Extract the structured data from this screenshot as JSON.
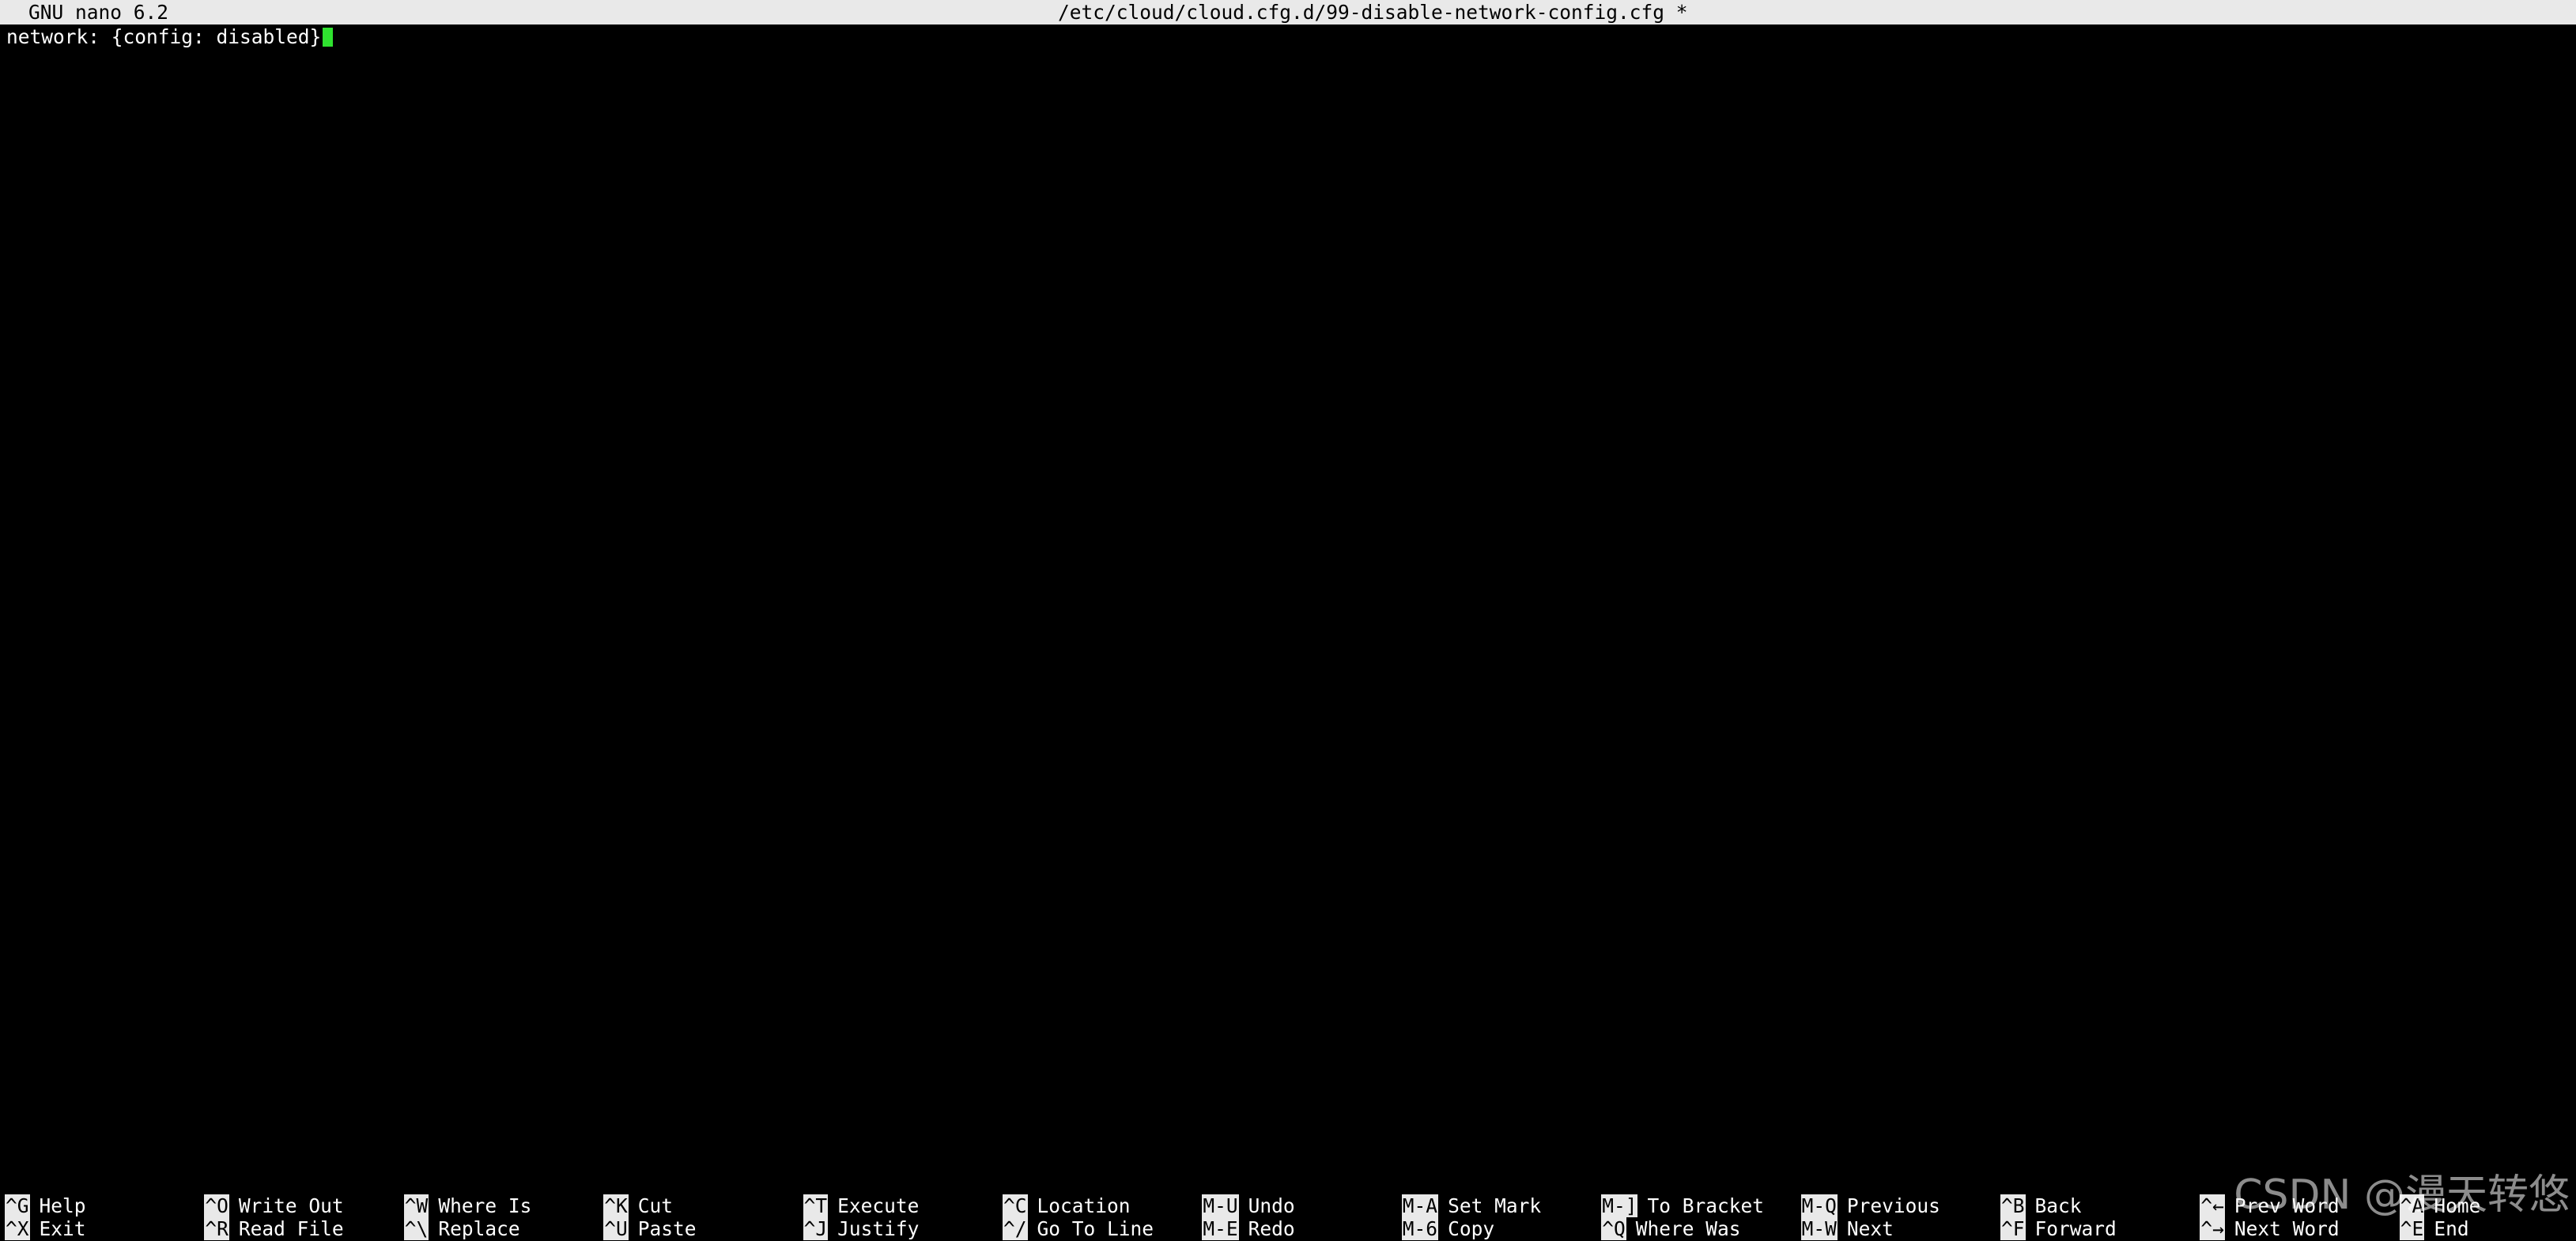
{
  "titlebar": {
    "app": "GNU nano 6.2",
    "file": "/etc/cloud/cloud.cfg.d/99-disable-network-config.cfg *"
  },
  "editor": {
    "lines": [
      "network: {config: disabled}"
    ]
  },
  "cursor_color": "#2fe22f",
  "shortcuts": [
    [
      {
        "key": "^G",
        "label": "Help"
      },
      {
        "key": "^X",
        "label": "Exit"
      }
    ],
    [
      {
        "key": "^O",
        "label": "Write Out"
      },
      {
        "key": "^R",
        "label": "Read File"
      }
    ],
    [
      {
        "key": "^W",
        "label": "Where Is"
      },
      {
        "key": "^\\",
        "label": "Replace"
      }
    ],
    [
      {
        "key": "^K",
        "label": "Cut"
      },
      {
        "key": "^U",
        "label": "Paste"
      }
    ],
    [
      {
        "key": "^T",
        "label": "Execute"
      },
      {
        "key": "^J",
        "label": "Justify"
      }
    ],
    [
      {
        "key": "^C",
        "label": "Location"
      },
      {
        "key": "^/",
        "label": "Go To Line"
      }
    ],
    [
      {
        "key": "M-U",
        "label": "Undo"
      },
      {
        "key": "M-E",
        "label": "Redo"
      }
    ],
    [
      {
        "key": "M-A",
        "label": "Set Mark"
      },
      {
        "key": "M-6",
        "label": "Copy"
      }
    ],
    [
      {
        "key": "M-]",
        "label": "To Bracket"
      },
      {
        "key": "^Q",
        "label": "Where Was"
      }
    ],
    [
      {
        "key": "M-Q",
        "label": "Previous"
      },
      {
        "key": "M-W",
        "label": "Next"
      }
    ],
    [
      {
        "key": "^B",
        "label": "Back"
      },
      {
        "key": "^F",
        "label": "Forward"
      }
    ],
    [
      {
        "key": "^←",
        "label": "Prev Word"
      },
      {
        "key": "^→",
        "label": "Next Word"
      }
    ],
    [
      {
        "key": "^A",
        "label": "Home"
      },
      {
        "key": "^E",
        "label": "End"
      }
    ]
  ],
  "watermark": "CSDN @漫天转悠"
}
